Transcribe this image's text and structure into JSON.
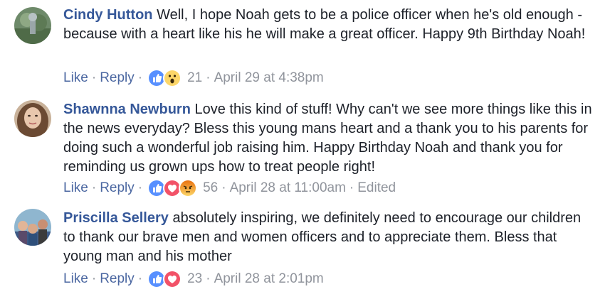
{
  "comments": [
    {
      "author": "Cindy Hutton",
      "text": "Well, I hope Noah gets to be a police officer when he's old enough - because with a heart like his he will make a great officer. Happy 9th Birthday Noah!",
      "like_label": "Like",
      "reply_label": "Reply",
      "reactions": [
        "like-icon",
        "wow-icon"
      ],
      "reaction_count": "21",
      "timestamp": "April 29 at 4:38pm",
      "edited_label": ""
    },
    {
      "author": "Shawnna Newburn",
      "text": "Love this kind of stuff! Why can't we see more things like this in the news everyday? Bless this young mans heart and a thank you to his parents for doing such a wonderful job raising him. Happy Birthday Noah and thank you for reminding us grown ups how to treat people right!",
      "like_label": "Like",
      "reply_label": "Reply",
      "reactions": [
        "like-icon",
        "love-icon",
        "angry-icon"
      ],
      "reaction_count": "56",
      "timestamp": "April 28 at 11:00am",
      "edited_label": "Edited"
    },
    {
      "author": "Priscilla Sellery",
      "text": "absolutely inspiring, we definitely need to encourage our children to thank our brave men and women officers and to appreciate them. Bless that young man and his mother",
      "like_label": "Like",
      "reply_label": "Reply",
      "reactions": [
        "like-icon",
        "love-icon"
      ],
      "reaction_count": "23",
      "timestamp": "April 28 at 2:01pm",
      "edited_label": ""
    }
  ],
  "colors": {
    "link": "#4b67a1",
    "author": "#365899",
    "meta": "#90949c",
    "like_blue": "#5890ff",
    "love_red": "#f25268",
    "wow_yellow": "#fcd669",
    "angry_orange": "#e9710f"
  }
}
